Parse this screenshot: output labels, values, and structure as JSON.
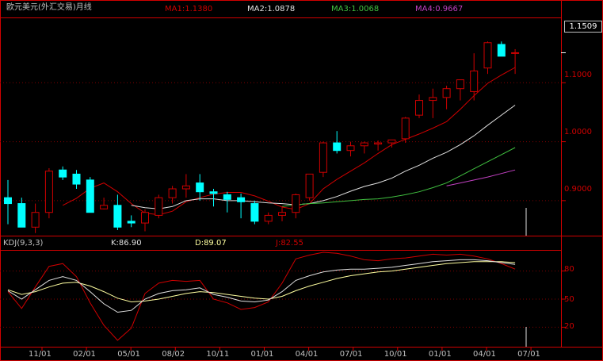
{
  "header": {
    "title": "欧元美元(外汇交易)月线",
    "ma": [
      {
        "label": "MA1:1.1380",
        "color": "#d00000"
      },
      {
        "label": "MA2:1.0878",
        "color": "#e0e0e0"
      },
      {
        "label": "MA3:1.0068",
        "color": "#40c040"
      },
      {
        "label": "MA4:0.9667",
        "color": "#c040c0"
      }
    ]
  },
  "price_panel": {
    "current_price": "1.1509",
    "ticks": [
      "1.1000",
      "1.0000",
      "0.9000"
    ]
  },
  "kdj_panel": {
    "label": "KDJ(9,3,3)",
    "k": "K:86.90",
    "d": "D:89.07",
    "j": "J:82.55",
    "ticks": [
      "80",
      "50",
      "20"
    ]
  },
  "x_axis": {
    "labels": [
      "11/01",
      "02/01",
      "05/01",
      "08/02",
      "10/11",
      "01/01",
      "04/01",
      "07/01",
      "10/01",
      "01/01",
      "04/01",
      "07/01"
    ]
  },
  "colors": {
    "up": "#d00000",
    "down": "#00ffff",
    "ma1": "#d00000",
    "ma2": "#e0e0e0",
    "ma3": "#40c040",
    "ma4": "#c040c0",
    "k": "#e0e0e0",
    "d": "#ffffa0",
    "j": "#d00000",
    "border": "#d00000"
  },
  "chart_data": {
    "type": "candlestick",
    "title": "欧元美元(外汇交易)月线",
    "ylim": [
      0.85,
      1.2
    ],
    "candles": [
      {
        "o": 0.905,
        "h": 0.935,
        "l": 0.86,
        "c": 0.895
      },
      {
        "o": 0.895,
        "h": 0.905,
        "l": 0.855,
        "c": 0.855
      },
      {
        "o": 0.855,
        "h": 0.895,
        "l": 0.845,
        "c": 0.88
      },
      {
        "o": 0.88,
        "h": 0.955,
        "l": 0.87,
        "c": 0.95
      },
      {
        "o": 0.952,
        "h": 0.958,
        "l": 0.935,
        "c": 0.94
      },
      {
        "o": 0.945,
        "h": 0.952,
        "l": 0.92,
        "c": 0.928
      },
      {
        "o": 0.935,
        "h": 0.94,
        "l": 0.88,
        "c": 0.88
      },
      {
        "o": 0.886,
        "h": 0.905,
        "l": 0.885,
        "c": 0.892
      },
      {
        "o": 0.892,
        "h": 0.91,
        "l": 0.85,
        "c": 0.855
      },
      {
        "o": 0.865,
        "h": 0.875,
        "l": 0.855,
        "c": 0.862
      },
      {
        "o": 0.862,
        "h": 0.885,
        "l": 0.848,
        "c": 0.88
      },
      {
        "o": 0.875,
        "h": 0.91,
        "l": 0.87,
        "c": 0.905
      },
      {
        "o": 0.905,
        "h": 0.925,
        "l": 0.895,
        "c": 0.92
      },
      {
        "o": 0.92,
        "h": 0.945,
        "l": 0.905,
        "c": 0.925
      },
      {
        "o": 0.93,
        "h": 0.945,
        "l": 0.9,
        "c": 0.915
      },
      {
        "o": 0.915,
        "h": 0.92,
        "l": 0.89,
        "c": 0.912
      },
      {
        "o": 0.91,
        "h": 0.915,
        "l": 0.88,
        "c": 0.902
      },
      {
        "o": 0.905,
        "h": 0.912,
        "l": 0.87,
        "c": 0.898
      },
      {
        "o": 0.895,
        "h": 0.9,
        "l": 0.86,
        "c": 0.865
      },
      {
        "o": 0.865,
        "h": 0.88,
        "l": 0.86,
        "c": 0.875
      },
      {
        "o": 0.875,
        "h": 0.89,
        "l": 0.865,
        "c": 0.88
      },
      {
        "o": 0.88,
        "h": 0.912,
        "l": 0.87,
        "c": 0.91
      },
      {
        "o": 0.905,
        "h": 0.945,
        "l": 0.9,
        "c": 0.945
      },
      {
        "o": 0.948,
        "h": 1.0,
        "l": 0.94,
        "c": 0.998
      },
      {
        "o": 0.998,
        "h": 1.018,
        "l": 0.98,
        "c": 0.985
      },
      {
        "o": 0.985,
        "h": 1.0,
        "l": 0.975,
        "c": 0.993
      },
      {
        "o": 0.993,
        "h": 1.0,
        "l": 0.98,
        "c": 0.998
      },
      {
        "o": 0.996,
        "h": 1.002,
        "l": 0.985,
        "c": 0.998
      },
      {
        "o": 0.998,
        "h": 1.003,
        "l": 0.99,
        "c": 1.003
      },
      {
        "o": 1.005,
        "h": 1.042,
        "l": 0.998,
        "c": 1.04
      },
      {
        "o": 1.045,
        "h": 1.08,
        "l": 1.04,
        "c": 1.07
      },
      {
        "o": 1.07,
        "h": 1.09,
        "l": 1.04,
        "c": 1.075
      },
      {
        "o": 1.075,
        "h": 1.095,
        "l": 1.055,
        "c": 1.09
      },
      {
        "o": 1.09,
        "h": 1.105,
        "l": 1.07,
        "c": 1.105
      },
      {
        "o": 1.085,
        "h": 1.15,
        "l": 1.07,
        "c": 1.12
      },
      {
        "o": 1.125,
        "h": 1.17,
        "l": 1.115,
        "c": 1.168
      },
      {
        "o": 1.165,
        "h": 1.17,
        "l": 1.145,
        "c": 1.145
      },
      {
        "o": 1.15,
        "h": 1.157,
        "l": 1.115,
        "c": 1.151
      }
    ],
    "ma": {
      "ma1": [
        null,
        null,
        null,
        null,
        0.892,
        0.904,
        0.921,
        0.93,
        0.915,
        0.895,
        0.879,
        0.876,
        0.882,
        0.898,
        0.905,
        0.911,
        0.914,
        0.914,
        0.908,
        0.899,
        0.889,
        0.885,
        0.895,
        0.92,
        0.936,
        0.95,
        0.964,
        0.98,
        0.995,
        1.004,
        1.013,
        1.023,
        1.034,
        1.055,
        1.078,
        1.099,
        1.113,
        1.126
      ],
      "ma2": [
        null,
        null,
        null,
        null,
        null,
        null,
        null,
        null,
        null,
        0.892,
        0.888,
        0.886,
        0.89,
        0.9,
        0.903,
        0.903,
        0.9,
        0.9,
        0.898,
        0.896,
        0.895,
        0.893,
        0.895,
        0.9,
        0.907,
        0.916,
        0.924,
        0.93,
        0.938,
        0.95,
        0.96,
        0.972,
        0.982,
        0.995,
        1.01,
        1.028,
        1.045,
        1.062
      ],
      "ma3": [
        null,
        null,
        null,
        null,
        null,
        null,
        null,
        null,
        null,
        null,
        null,
        null,
        null,
        null,
        null,
        null,
        null,
        null,
        null,
        null,
        0.89,
        0.893,
        0.895,
        0.896,
        0.898,
        0.9,
        0.902,
        0.903,
        0.906,
        0.91,
        0.915,
        0.922,
        0.93,
        0.942,
        0.954,
        0.966,
        0.978,
        0.99
      ],
      "ma4": [
        null,
        null,
        null,
        null,
        null,
        null,
        null,
        null,
        null,
        null,
        null,
        null,
        null,
        null,
        null,
        null,
        null,
        null,
        null,
        null,
        null,
        null,
        null,
        null,
        null,
        null,
        null,
        null,
        null,
        null,
        null,
        null,
        0.925,
        0.93,
        0.935,
        0.94,
        0.946,
        0.952
      ]
    },
    "kdj": {
      "ylim": [
        0,
        100
      ],
      "k": [
        59,
        50,
        60,
        70,
        74,
        70,
        58,
        45,
        36,
        38,
        50,
        56,
        59,
        60,
        62,
        55,
        52,
        48,
        47,
        49,
        58,
        70,
        75,
        79,
        81,
        82,
        82,
        83,
        84,
        86,
        88,
        90,
        91,
        92,
        92,
        91,
        89,
        87
      ],
      "d": [
        60,
        55,
        58,
        63,
        67,
        68,
        64,
        58,
        51,
        47,
        48,
        50,
        53,
        56,
        58,
        57,
        55,
        53,
        51,
        50,
        53,
        59,
        64,
        68,
        72,
        75,
        77,
        79,
        80,
        82,
        84,
        86,
        88,
        89,
        90,
        90,
        90,
        89
      ],
      "j": [
        58,
        40,
        63,
        85,
        88,
        74,
        46,
        22,
        6,
        19,
        56,
        67,
        70,
        69,
        70,
        50,
        46,
        39,
        41,
        47,
        67,
        93,
        97,
        100,
        99,
        96,
        92,
        91,
        93,
        94,
        96,
        98,
        97,
        98,
        96,
        93,
        88,
        82
      ]
    }
  }
}
